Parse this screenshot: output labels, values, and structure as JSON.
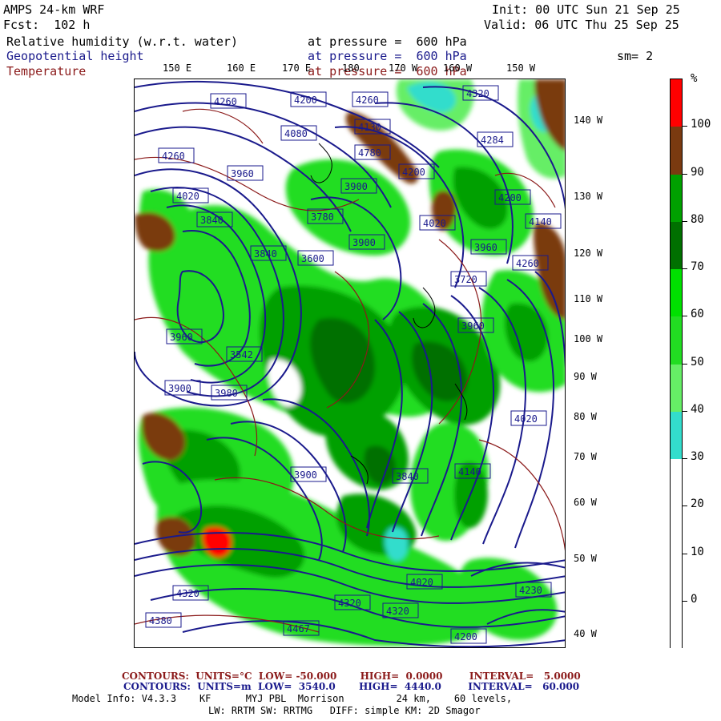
{
  "header": {
    "model": "AMPS 24-km WRF",
    "forecast": "Fcst:  102 h",
    "init": "Init: 00 UTC Sun 21 Sep 25",
    "valid": "Valid: 06 UTC Thu 25 Sep 25"
  },
  "fields": [
    {
      "name": "Relative humidity (w.r.t. water)",
      "level": "at pressure =  600 hPa",
      "color": "#000000"
    },
    {
      "name": "Geopotential height",
      "level": "at pressure =  600 hPa",
      "color": "#1a1a8c"
    },
    {
      "name": "Temperature",
      "level": "at pressure =  600 hPa",
      "color": "#8b1a1a"
    }
  ],
  "smoothing": "sm= 2",
  "lon_labels": [
    "150 E",
    "160 E",
    "170 E",
    "180",
    "170 W",
    "160 W",
    "150 W"
  ],
  "lat_labels": [
    "140 W",
    "130 W",
    "120 W",
    "110 W",
    "100 W",
    "90 W",
    "80 W",
    "70 W",
    "60 W",
    "50 W",
    "40 W"
  ],
  "colorbar": {
    "unit": "%",
    "labels": [
      "100",
      "90",
      "80",
      "70",
      "60",
      "50",
      "40",
      "30",
      "20",
      "10",
      "0"
    ],
    "colors": [
      "#ff0000",
      "#7a3a10",
      "#00a000",
      "#007000",
      "#00e000",
      "#22dd22",
      "#66ee66",
      "#33ddcc",
      "#ffffff",
      "#ffffff",
      "#ffffff",
      "#ffffff"
    ]
  },
  "height_labels": [
    "4260",
    "4200",
    "4260",
    "4320",
    "4080",
    "4130",
    "4284",
    "4260",
    "3960",
    "4780",
    "4200",
    "4020",
    "3900",
    "4200",
    "4140",
    "4020",
    "3840",
    "3780",
    "3900",
    "3960",
    "3840",
    "3600",
    "3960",
    "4260",
    "3720",
    "3542",
    "3960",
    "3900",
    "3980",
    "4020",
    "3840",
    "3900",
    "4140",
    "4320",
    "4380",
    "4320",
    "4320",
    "4230",
    "4467",
    "4020",
    "4200"
  ],
  "footer": {
    "temp_contours": "CONTOURS:  UNITS=°C  LOW= -50.000       HIGH=  0.0000        INTERVAL=   5.0000",
    "height_contours": "CONTOURS:  UNITS=m  LOW=  3540.0       HIGH=  4440.0        INTERVAL=   60.000",
    "model_info": "Model Info: V4.3.3    KF      MYJ PBL  Morrison         24 km,    60 levels,",
    "physics": "LW: RRTM SW: RRTMG   DIFF: simple KM: 2D Smagor"
  }
}
